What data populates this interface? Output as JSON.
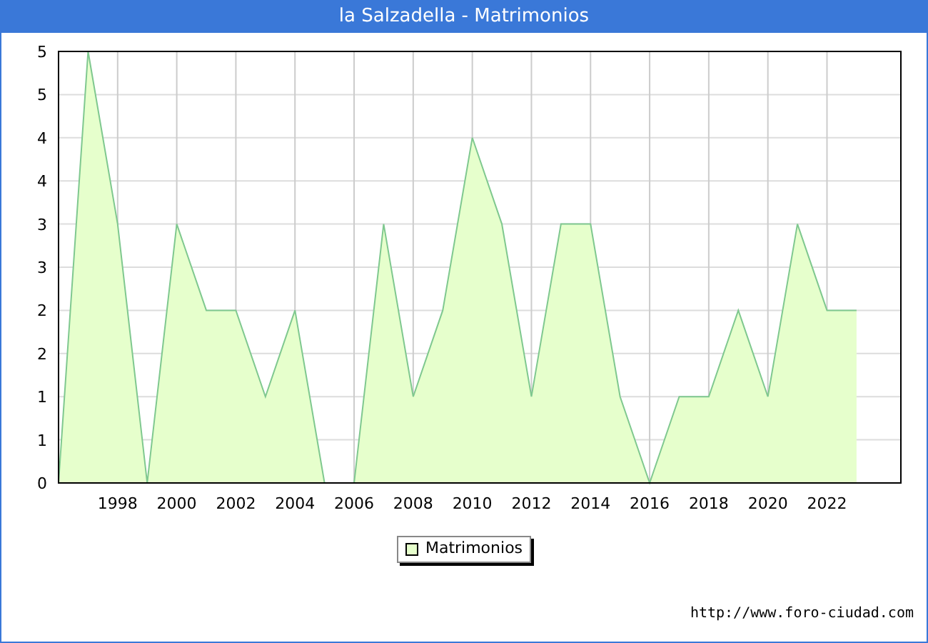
{
  "window": {
    "title": "la Salzadella - Matrimonios"
  },
  "chart": {
    "chart_data": {
      "type": "area",
      "x": [
        1996,
        1997,
        1998,
        1999,
        2000,
        2001,
        2002,
        2003,
        2004,
        2005,
        2006,
        2007,
        2008,
        2009,
        2010,
        2011,
        2012,
        2013,
        2014,
        2015,
        2016,
        2017,
        2018,
        2019,
        2020,
        2021,
        2022,
        2023
      ],
      "series": [
        {
          "name": "Matrimonios",
          "color": "#e6ffcc",
          "values": [
            0,
            5,
            3,
            0,
            3,
            2,
            2,
            1,
            2,
            0,
            0,
            3,
            1,
            2,
            4,
            3,
            1,
            3,
            3,
            1,
            0,
            1,
            1,
            2,
            1,
            3,
            2,
            2
          ]
        }
      ],
      "grid": true,
      "xlim": [
        1996,
        2024.5
      ],
      "ylim": [
        0,
        5
      ],
      "xticks": [
        1998,
        2000,
        2002,
        2004,
        2006,
        2008,
        2010,
        2012,
        2014,
        2016,
        2018,
        2020,
        2022
      ],
      "yticks": [
        {
          "value": 0,
          "label": "0"
        },
        {
          "value": 0.5,
          "label": "1"
        },
        {
          "value": 1,
          "label": "1"
        },
        {
          "value": 1.5,
          "label": "2"
        },
        {
          "value": 2,
          "label": "2"
        },
        {
          "value": 2.5,
          "label": "3"
        },
        {
          "value": 3,
          "label": "3"
        },
        {
          "value": 3.5,
          "label": "4"
        },
        {
          "value": 4,
          "label": "4"
        },
        {
          "value": 4.5,
          "label": "5"
        },
        {
          "value": 5,
          "label": "5"
        }
      ]
    }
  },
  "footer": {
    "url": "http://www.foro-ciudad.com"
  }
}
